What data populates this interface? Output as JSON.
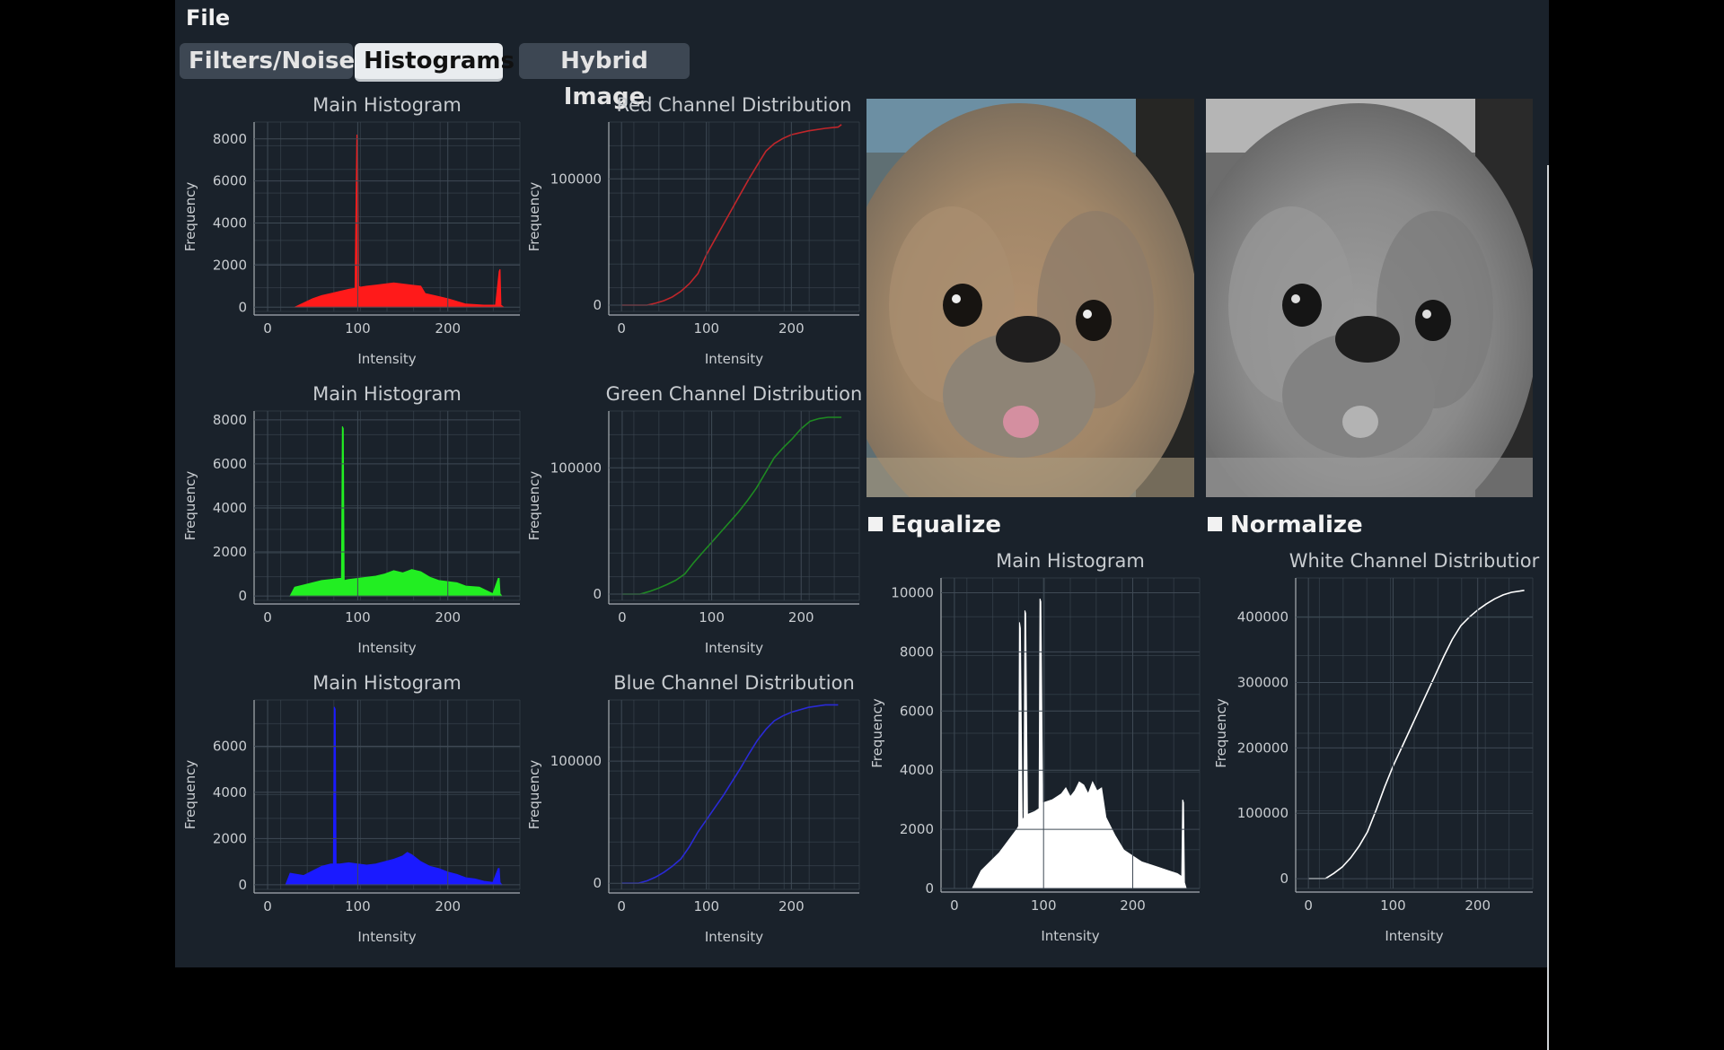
{
  "menu": {
    "file": "File"
  },
  "tabs": [
    {
      "label": "Filters/Noise",
      "active": false
    },
    {
      "label": "Histograms",
      "active": true
    },
    {
      "label": "Hybrid Image",
      "active": false
    }
  ],
  "images": {
    "original_alt": "original-color-photo",
    "gray_alt": "grayscale-photo"
  },
  "checkboxes": {
    "equalize": "Equalize",
    "normalize": "Normalize"
  },
  "colors": {
    "red": "#ff1a1a",
    "green": "#22ee22",
    "blue": "#1a1aff",
    "white": "#ffffff",
    "red_cdf": "#c0262b",
    "green_cdf": "#1e8a22",
    "blue_cdf": "#2a2ad6",
    "white_cdf": "#ffffff"
  },
  "chart_data": [
    {
      "id": "red-hist",
      "type": "area",
      "title": "Main Histogram",
      "xlabel": "Intensity",
      "ylabel": "Frequency",
      "xlim": [
        -15,
        280
      ],
      "ylim": [
        -200,
        8800
      ],
      "xticks": [
        0,
        100,
        200
      ],
      "yticks": [
        0,
        2000,
        4000,
        6000,
        8000
      ],
      "color": "red",
      "x": [
        30,
        40,
        50,
        60,
        70,
        80,
        90,
        97,
        99,
        100,
        101,
        103,
        110,
        120,
        130,
        140,
        150,
        160,
        170,
        175,
        185,
        200,
        220,
        240,
        253,
        257,
        258,
        259,
        262
      ],
      "y": [
        0,
        200,
        400,
        550,
        650,
        750,
        850,
        900,
        8200,
        8100,
        1000,
        950,
        1000,
        1050,
        1100,
        1150,
        1100,
        1050,
        1000,
        650,
        550,
        400,
        150,
        100,
        100,
        1700,
        1800,
        100,
        0
      ]
    },
    {
      "id": "red-cdf",
      "type": "line",
      "title": "Red Channel Distribution",
      "xlabel": "Intensity",
      "ylabel": "Frequency",
      "xlim": [
        -15,
        280
      ],
      "ylim": [
        -5000,
        145000
      ],
      "xticks": [
        0,
        100,
        200
      ],
      "yticks": [
        0,
        100000
      ],
      "color": "red_cdf",
      "x": [
        0,
        30,
        40,
        50,
        60,
        70,
        80,
        90,
        100,
        110,
        120,
        130,
        140,
        150,
        160,
        170,
        180,
        190,
        200,
        220,
        240,
        255,
        259
      ],
      "y": [
        0,
        0,
        1500,
        3500,
        6500,
        11000,
        17000,
        25000,
        40000,
        52000,
        64000,
        76000,
        88000,
        100000,
        111000,
        122000,
        128000,
        132000,
        135000,
        138000,
        140000,
        141000,
        143000
      ]
    },
    {
      "id": "green-hist",
      "type": "area",
      "title": "Main Histogram",
      "xlabel": "Intensity",
      "ylabel": "Frequency",
      "xlim": [
        -15,
        280
      ],
      "ylim": [
        -200,
        8400
      ],
      "xticks": [
        0,
        100,
        200
      ],
      "yticks": [
        0,
        2000,
        4000,
        6000,
        8000
      ],
      "color": "green",
      "x": [
        25,
        30,
        40,
        50,
        60,
        70,
        80,
        82,
        83,
        84,
        85,
        90,
        100,
        110,
        120,
        130,
        140,
        150,
        160,
        170,
        180,
        190,
        200,
        210,
        220,
        235,
        250,
        256,
        257,
        258,
        260
      ],
      "y": [
        0,
        400,
        500,
        600,
        700,
        750,
        800,
        800,
        7700,
        7600,
        700,
        750,
        800,
        850,
        900,
        1000,
        1150,
        1050,
        1200,
        1100,
        850,
        700,
        650,
        600,
        450,
        400,
        100,
        800,
        800,
        100,
        0
      ]
    },
    {
      "id": "green-cdf",
      "type": "line",
      "title": "Green Channel Distribution",
      "xlabel": "Intensity",
      "ylabel": "Frequency",
      "xlim": [
        -15,
        265
      ],
      "ylim": [
        -5000,
        145000
      ],
      "xticks": [
        0,
        100,
        200
      ],
      "yticks": [
        0,
        100000
      ],
      "color": "green_cdf",
      "x": [
        0,
        20,
        30,
        40,
        50,
        60,
        70,
        80,
        90,
        100,
        110,
        120,
        130,
        140,
        150,
        160,
        170,
        180,
        190,
        200,
        210,
        220,
        230,
        245
      ],
      "y": [
        0,
        0,
        2000,
        4500,
        7500,
        11000,
        16000,
        25000,
        33000,
        41000,
        49000,
        57000,
        65000,
        74000,
        84000,
        96000,
        108000,
        116000,
        123000,
        131000,
        137000,
        139000,
        140000,
        140000
      ]
    },
    {
      "id": "blue-hist",
      "type": "area",
      "title": "Main Histogram",
      "xlabel": "Intensity",
      "ylabel": "Frequency",
      "xlim": [
        -15,
        280
      ],
      "ylim": [
        -200,
        8000
      ],
      "xticks": [
        0,
        100,
        200
      ],
      "yticks": [
        0,
        2000,
        4000,
        6000
      ],
      "color": "blue",
      "x": [
        20,
        25,
        40,
        50,
        60,
        70,
        73,
        74,
        75,
        76,
        80,
        90,
        100,
        110,
        120,
        130,
        140,
        150,
        155,
        160,
        170,
        180,
        190,
        200,
        210,
        220,
        230,
        240,
        250,
        256,
        257,
        258,
        260
      ],
      "y": [
        0,
        500,
        400,
        600,
        800,
        900,
        900,
        7700,
        7600,
        900,
        900,
        950,
        900,
        850,
        900,
        1000,
        1100,
        1250,
        1400,
        1300,
        1000,
        800,
        700,
        550,
        450,
        300,
        250,
        150,
        100,
        700,
        700,
        100,
        0
      ]
    },
    {
      "id": "blue-cdf",
      "type": "line",
      "title": "Blue Channel Distribution",
      "xlabel": "Intensity",
      "ylabel": "Frequency",
      "xlim": [
        -15,
        280
      ],
      "ylim": [
        -5000,
        150000
      ],
      "xticks": [
        0,
        100,
        200
      ],
      "yticks": [
        0,
        100000
      ],
      "color": "blue_cdf",
      "x": [
        0,
        20,
        30,
        40,
        50,
        60,
        70,
        80,
        90,
        100,
        110,
        120,
        130,
        140,
        150,
        160,
        170,
        180,
        190,
        200,
        210,
        220,
        230,
        240,
        255
      ],
      "y": [
        0,
        0,
        2000,
        5000,
        9000,
        14000,
        20000,
        30000,
        42000,
        52000,
        62000,
        72000,
        83000,
        94000,
        106000,
        117000,
        126000,
        133000,
        137000,
        140000,
        142000,
        144000,
        145000,
        146000,
        146000
      ]
    },
    {
      "id": "white-hist",
      "type": "area",
      "title": "Main Histogram",
      "xlabel": "Intensity",
      "ylabel": "Frequency",
      "xlim": [
        -15,
        275
      ],
      "ylim": [
        0,
        10500
      ],
      "xticks": [
        0,
        100,
        200
      ],
      "yticks": [
        0,
        2000,
        4000,
        6000,
        8000,
        10000
      ],
      "color": "white",
      "x": [
        20,
        30,
        40,
        50,
        60,
        70,
        72,
        73,
        74,
        76,
        78,
        79,
        80,
        82,
        90,
        95,
        96,
        97,
        99,
        100,
        110,
        120,
        125,
        130,
        135,
        140,
        145,
        150,
        155,
        160,
        165,
        170,
        180,
        190,
        200,
        210,
        220,
        230,
        240,
        250,
        255,
        256,
        257,
        258,
        260
      ],
      "y": [
        0,
        600,
        900,
        1200,
        1600,
        2000,
        2100,
        9000,
        8800,
        2300,
        2400,
        9400,
        9300,
        2500,
        2600,
        2700,
        9800,
        9700,
        2800,
        2900,
        3000,
        3200,
        3400,
        3100,
        3300,
        3600,
        3500,
        3200,
        3600,
        3300,
        3400,
        2400,
        1800,
        1300,
        1100,
        900,
        800,
        700,
        600,
        500,
        400,
        3000,
        2900,
        200,
        0
      ]
    },
    {
      "id": "white-cdf",
      "type": "line",
      "title": "White Channel Distributior",
      "xlabel": "Intensity",
      "ylabel": "Frequency",
      "xlim": [
        -15,
        265
      ],
      "ylim": [
        -15000,
        460000
      ],
      "xticks": [
        0,
        100,
        200
      ],
      "yticks": [
        0,
        100000,
        200000,
        300000,
        400000
      ],
      "color": "white_cdf",
      "x": [
        0,
        20,
        30,
        40,
        50,
        60,
        70,
        80,
        90,
        100,
        110,
        120,
        130,
        140,
        150,
        160,
        170,
        180,
        190,
        200,
        210,
        220,
        230,
        240,
        250,
        255
      ],
      "y": [
        0,
        0,
        8000,
        18000,
        32000,
        50000,
        72000,
        105000,
        140000,
        172000,
        200000,
        228000,
        256000,
        284000,
        312000,
        340000,
        366000,
        387000,
        400000,
        411000,
        420000,
        428000,
        434000,
        438000,
        440000,
        441000
      ]
    }
  ]
}
